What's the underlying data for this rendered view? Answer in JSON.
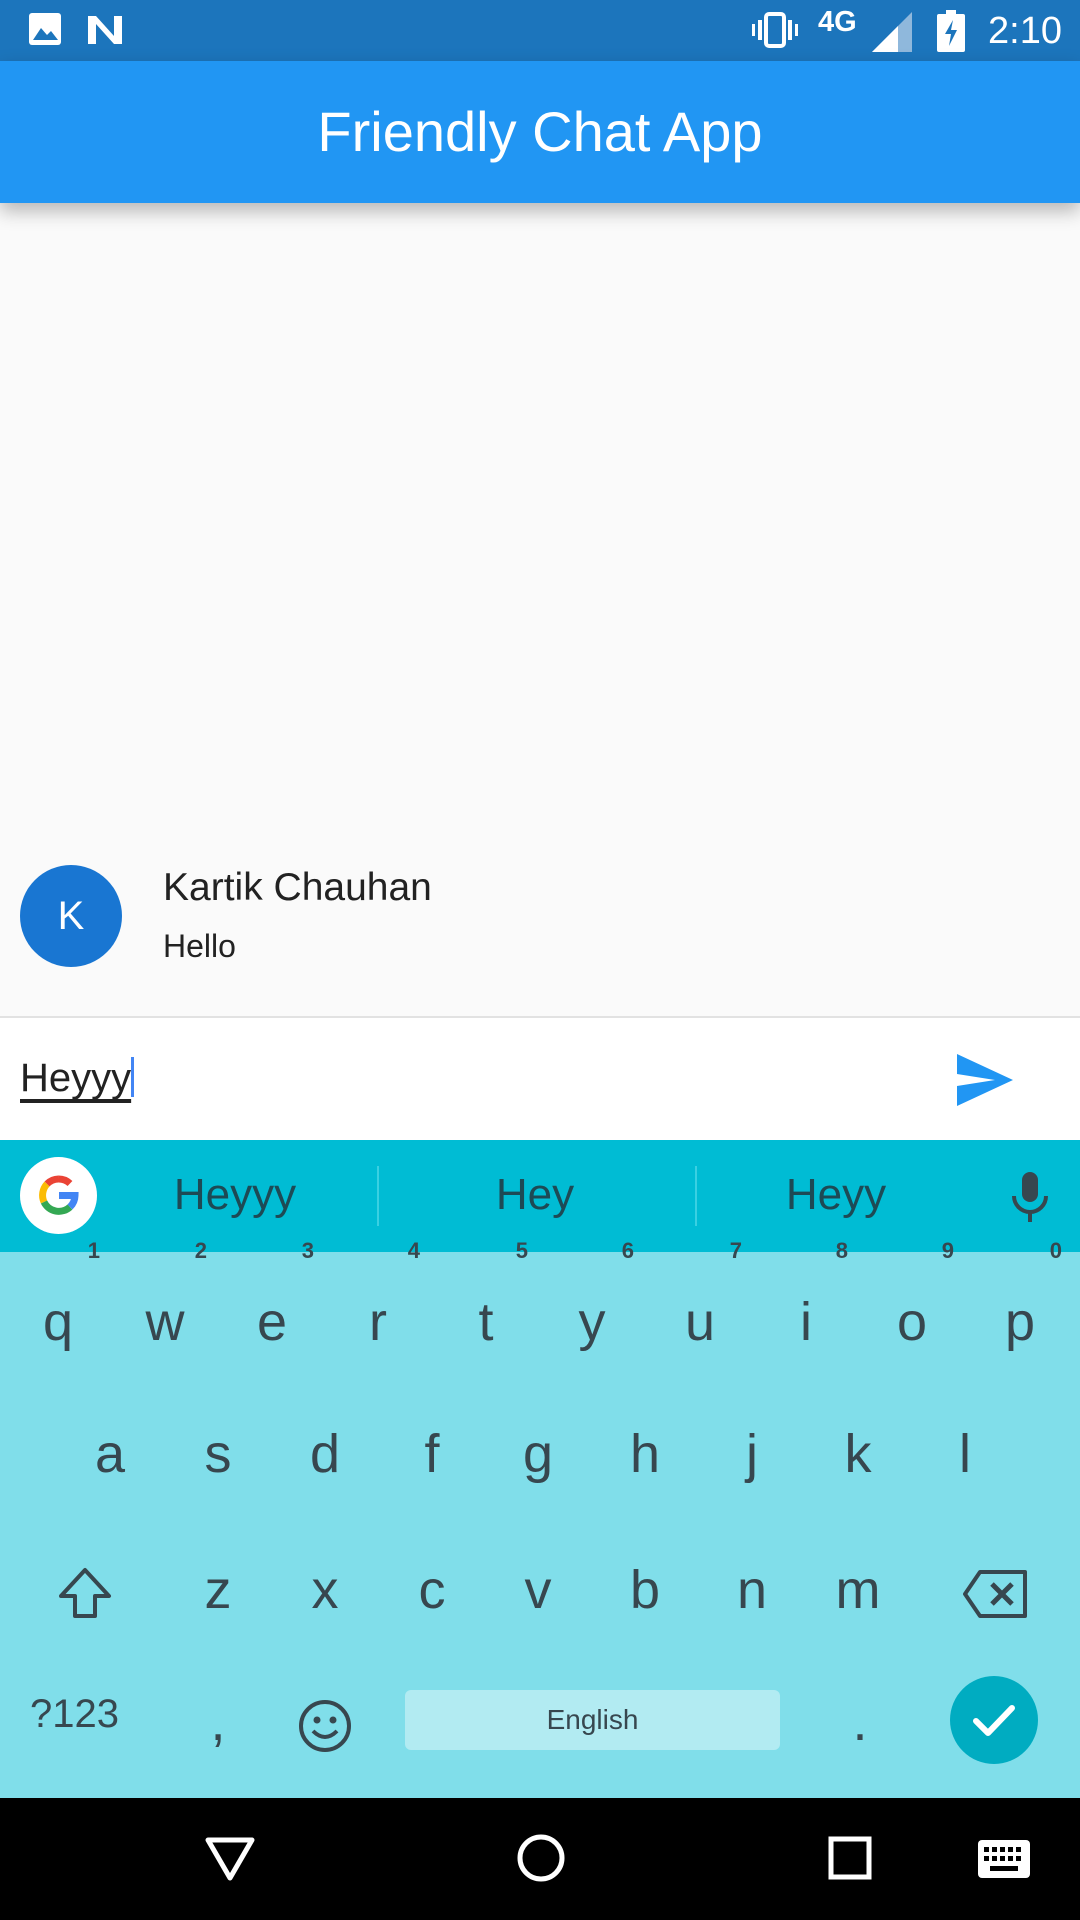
{
  "status_bar": {
    "network": "4G",
    "time": "2:10",
    "icons": [
      "image-icon",
      "n-icon",
      "vibrate-icon",
      "signal-icon",
      "battery-charging-icon"
    ]
  },
  "app_bar": {
    "title": "Friendly Chat App"
  },
  "messages": [
    {
      "avatar_initial": "K",
      "sender": "Kartik Chauhan",
      "text": "Hello"
    }
  ],
  "composer": {
    "value": "Heyyy",
    "send_icon": "send-icon"
  },
  "suggestions": {
    "items": [
      "Heyyy",
      "Hey",
      "Heyy"
    ],
    "mic_icon": "mic-icon",
    "logo": "google-logo-icon"
  },
  "keyboard": {
    "row1": [
      {
        "k": "q",
        "h": "1"
      },
      {
        "k": "w",
        "h": "2"
      },
      {
        "k": "e",
        "h": "3"
      },
      {
        "k": "r",
        "h": "4"
      },
      {
        "k": "t",
        "h": "5"
      },
      {
        "k": "y",
        "h": "6"
      },
      {
        "k": "u",
        "h": "7"
      },
      {
        "k": "i",
        "h": "8"
      },
      {
        "k": "o",
        "h": "9"
      },
      {
        "k": "p",
        "h": "0"
      }
    ],
    "row2": [
      "a",
      "s",
      "d",
      "f",
      "g",
      "h",
      "j",
      "k",
      "l"
    ],
    "row3": [
      "z",
      "x",
      "c",
      "v",
      "b",
      "n",
      "m"
    ],
    "symbols_label": "?123",
    "comma": ",",
    "period": ".",
    "space_label": "English"
  },
  "colors": {
    "status_bar": "#1c75bc",
    "app_bar": "#2196f3",
    "avatar": "#1976d2",
    "suggest_bar": "#00bcd4",
    "keyboard": "#80deea"
  }
}
